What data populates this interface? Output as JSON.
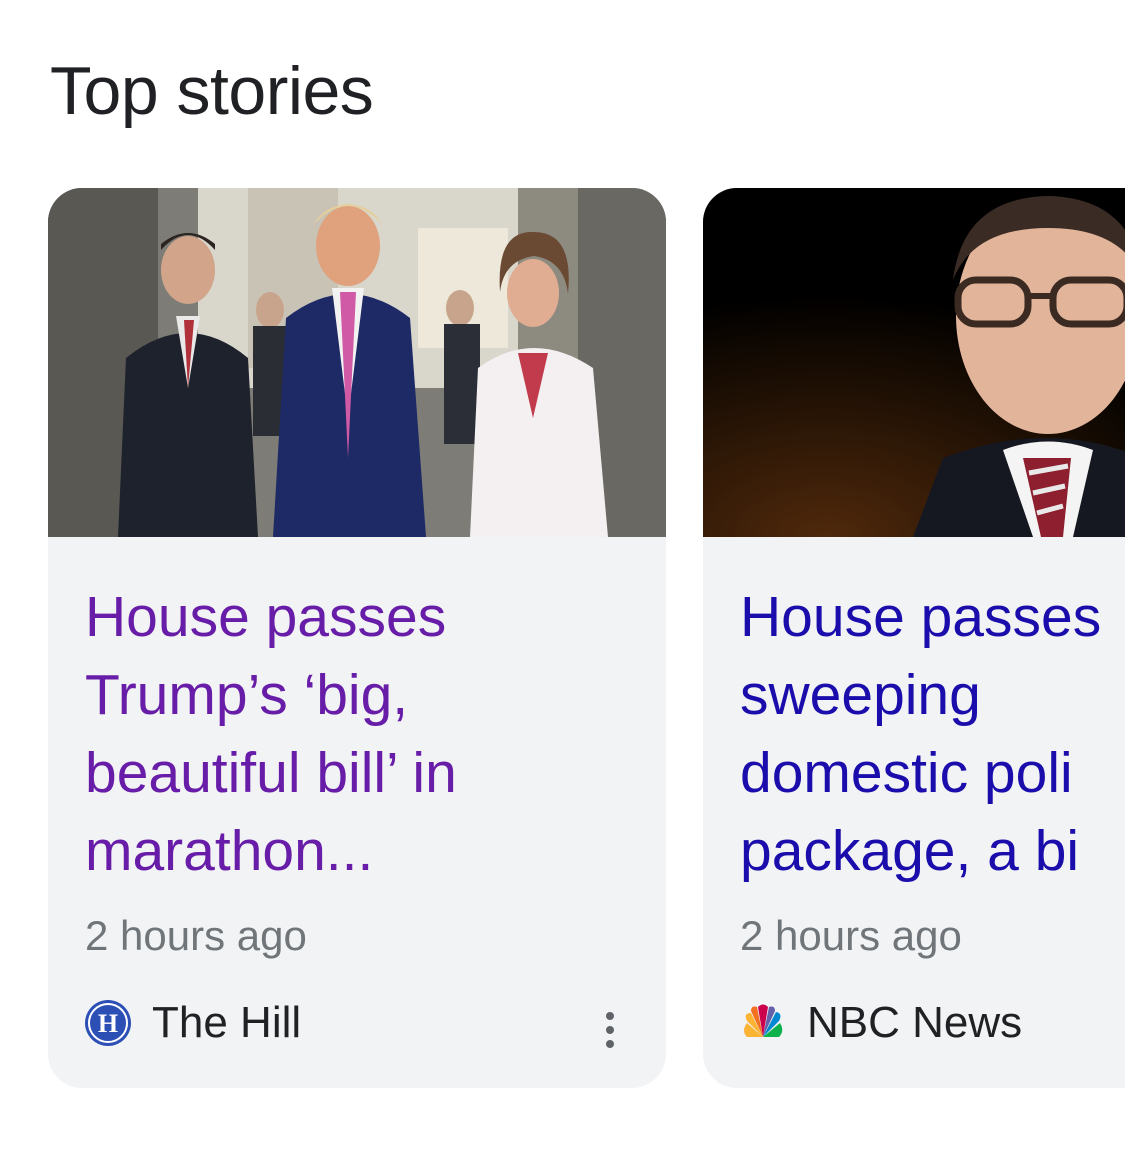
{
  "section": {
    "title": "Top stories"
  },
  "stories": [
    {
      "headline": "House passes\nTrump’s ‘big,\nbeautiful bill’ in\nmarathon...",
      "time": "2 hours ago",
      "source": "The Hill",
      "source_logo_letter": "H",
      "source_logo_icon": "the-hill-logo-icon",
      "headline_color": "#681da8",
      "visited": true
    },
    {
      "headline": "House passes\nsweeping\ndomestic poli\npackage, a bi",
      "time": "2 hours ago",
      "source": "NBC News",
      "source_logo_icon": "nbc-peacock-logo-icon",
      "headline_color": "#1a0dab",
      "visited": false
    }
  ],
  "icons": {
    "more": "more-vert-icon"
  },
  "colors": {
    "card_background": "#f2f3f5",
    "title_text": "#202124",
    "meta_text": "#70757a"
  }
}
